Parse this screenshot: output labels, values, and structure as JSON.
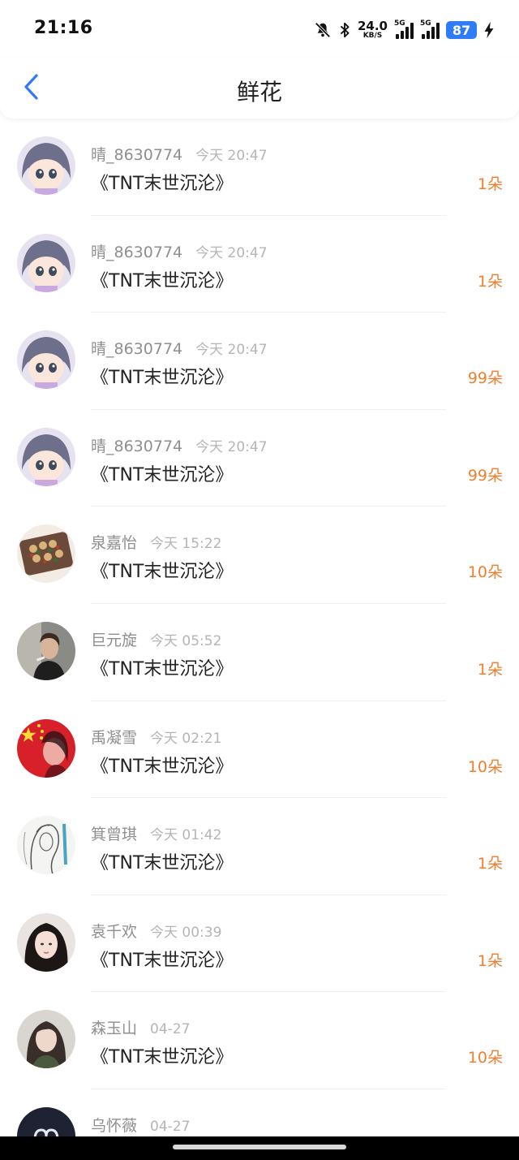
{
  "status_bar": {
    "time": "21:16",
    "net_speed_value": "24.0",
    "net_speed_unit": "KB/S",
    "signal1_tag": "5G",
    "signal2_tag": "5G",
    "battery": "87",
    "icons": [
      "bell-off-icon",
      "bluetooth-icon",
      "signal-icon",
      "signal-icon",
      "battery-icon",
      "charging-icon"
    ]
  },
  "header": {
    "title": "鲜花",
    "back_icon": "chevron-left-icon"
  },
  "colors": {
    "accent_blue": "#2f7cf6",
    "count_orange": "#f07f2f"
  },
  "rows": [
    {
      "user": "晴_8630774",
      "time": "今天 20:47",
      "book": "《TNT末世沉沦》",
      "count": "1朵"
    },
    {
      "user": "晴_8630774",
      "time": "今天 20:47",
      "book": "《TNT末世沉沦》",
      "count": "1朵"
    },
    {
      "user": "晴_8630774",
      "time": "今天 20:47",
      "book": "《TNT末世沉沦》",
      "count": "99朵"
    },
    {
      "user": "晴_8630774",
      "time": "今天 20:47",
      "book": "《TNT末世沉沦》",
      "count": "99朵"
    },
    {
      "user": "泉嘉怡",
      "time": "今天 15:22",
      "book": "《TNT末世沉沦》",
      "count": "10朵"
    },
    {
      "user": "巨元旋",
      "time": "今天 05:52",
      "book": "《TNT末世沉沦》",
      "count": "1朵"
    },
    {
      "user": "禹凝雪",
      "time": "今天 02:21",
      "book": "《TNT末世沉沦》",
      "count": "10朵"
    },
    {
      "user": "箕曾琪",
      "time": "今天 01:42",
      "book": "《TNT末世沉沦》",
      "count": "1朵"
    },
    {
      "user": "袁千欢",
      "time": "今天 00:39",
      "book": "《TNT末世沉沦》",
      "count": "1朵"
    },
    {
      "user": "森玉山",
      "time": "04-27",
      "book": "《TNT末世沉沦》",
      "count": "10朵"
    },
    {
      "user": "乌怀薇",
      "time": "04-27",
      "book": "",
      "count": ""
    }
  ]
}
